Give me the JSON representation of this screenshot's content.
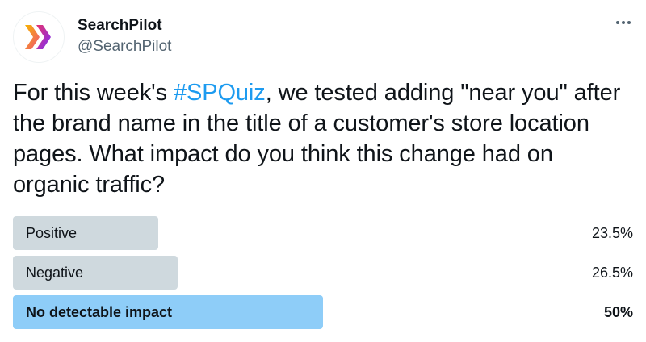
{
  "author": {
    "display_name": "SearchPilot",
    "handle": "@SearchPilot",
    "avatar_icon": "searchpilot-logo-icon"
  },
  "more_icon": "more-options-icon",
  "tweet": {
    "text_before": "For this week's ",
    "hashtag": "#SPQuiz",
    "text_after": ", we tested adding \"near you\" after the brand name in the title of a customer's store location pages. What impact do you think this change had on organic traffic?"
  },
  "poll": {
    "options": [
      {
        "label": "Positive",
        "percent_text": "23.5%",
        "percent": 23.5,
        "leader": false
      },
      {
        "label": "Negative",
        "percent_text": "26.5%",
        "percent": 26.5,
        "leader": false
      },
      {
        "label": "No detectable impact",
        "percent_text": "50%",
        "percent": 50,
        "leader": true
      }
    ]
  },
  "colors": {
    "bar": "#cfd9de",
    "leader_bar": "#8ecdf8",
    "hashtag": "#1d9bf0",
    "logo_orange": "#f5a623",
    "logo_pink": "#e8336d",
    "logo_purple": "#7b2ff7"
  }
}
